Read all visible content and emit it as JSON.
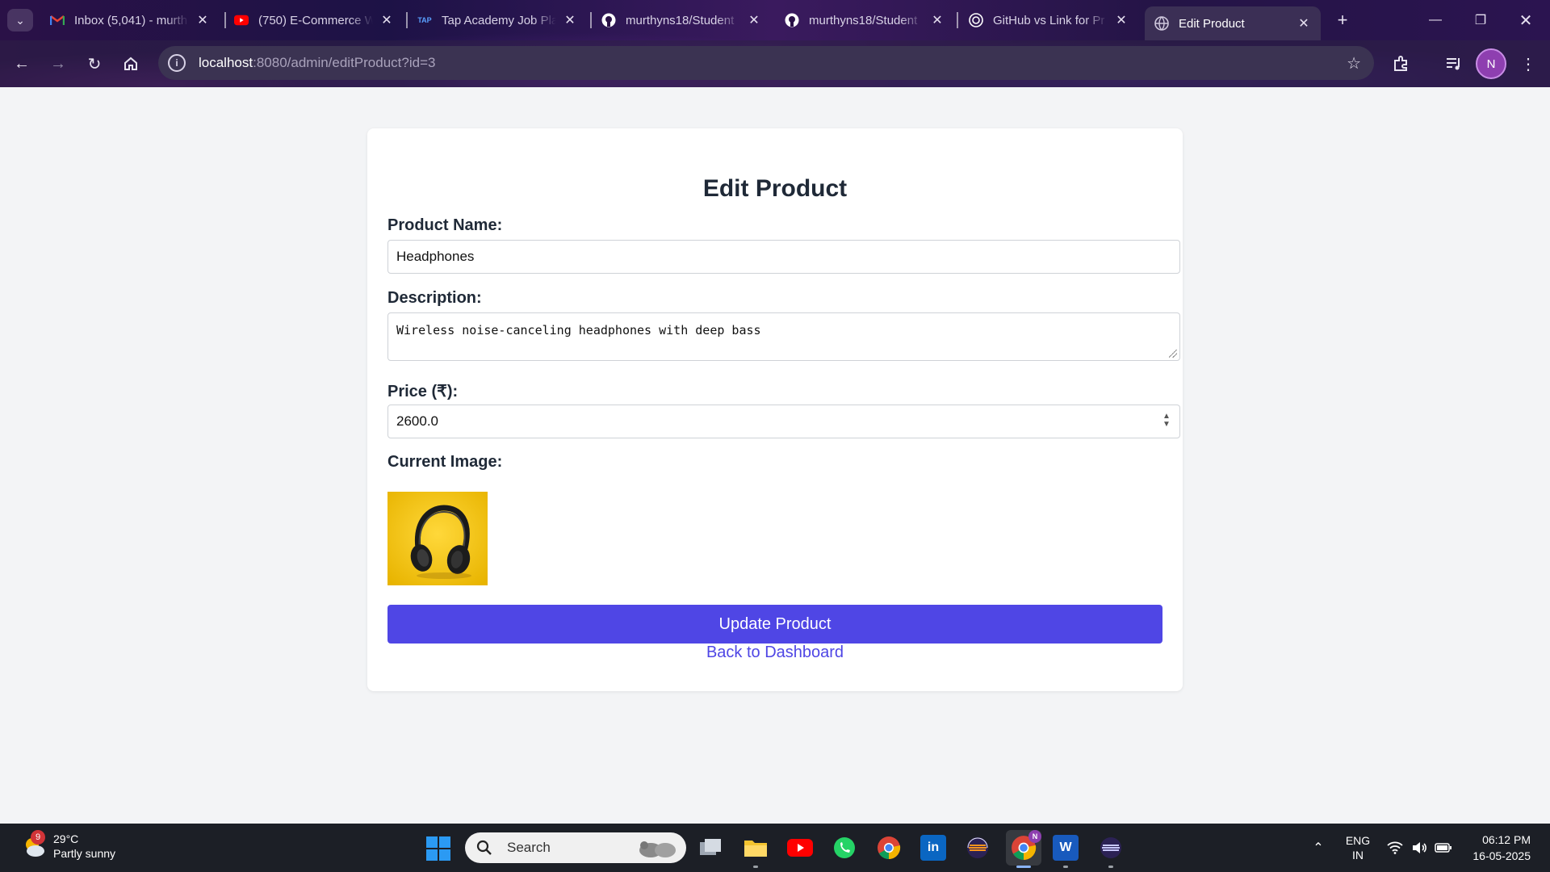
{
  "browser": {
    "tabs": [
      {
        "title": "Inbox (5,041) - murth",
        "icon": "gmail-icon"
      },
      {
        "title": "(750) E-Commerce W",
        "icon": "youtube-icon"
      },
      {
        "title": "Tap Academy Job Pla",
        "icon": "tap-academy-icon"
      },
      {
        "title": "murthyns18/Student",
        "icon": "github-icon"
      },
      {
        "title": "murthyns18/Student",
        "icon": "github-icon"
      },
      {
        "title": "GitHub vs Link for Pr",
        "icon": "chatgpt-icon"
      },
      {
        "title": "Edit Product",
        "icon": "globe-icon",
        "active": true
      }
    ],
    "url_host": "localhost",
    "url_rest": ":8080/admin/editProduct?id=3",
    "profile_initial": "N"
  },
  "form": {
    "title": "Edit Product",
    "name_label": "Product Name:",
    "name_value": "Headphones",
    "description_label": "Description:",
    "description_value": "Wireless noise-canceling headphones with deep bass",
    "price_label": "Price (₹):",
    "price_value": "2600.0",
    "image_label": "Current Image:",
    "update_button": "Update Product",
    "back_link": "Back to Dashboard"
  },
  "colors": {
    "accent": "#4f46e5",
    "page_bg": "#f3f4f6",
    "image_bg": "#f5c518"
  },
  "taskbar": {
    "weather_badge": "9",
    "temperature": "29°C",
    "condition": "Partly sunny",
    "search_placeholder": "Search",
    "lang_top": "ENG",
    "lang_bottom": "IN",
    "time": "06:12 PM",
    "date": "16-05-2025",
    "chrome_badge": "N"
  }
}
